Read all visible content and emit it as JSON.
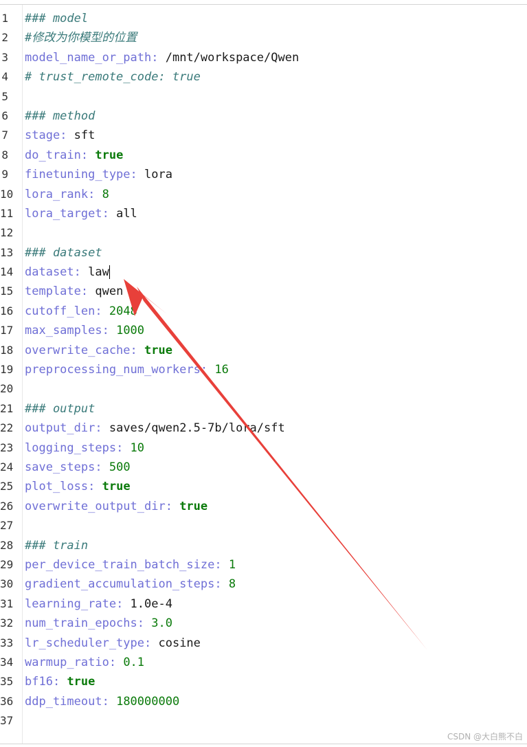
{
  "editor": {
    "lines": [
      {
        "n": "1",
        "tokens": [
          {
            "t": "### model",
            "c": "comment"
          }
        ]
      },
      {
        "n": "2",
        "tokens": [
          {
            "t": "#修改为你模型的位置",
            "c": "comment"
          }
        ]
      },
      {
        "n": "3",
        "tokens": [
          {
            "t": "model_name_or_path",
            "c": "key"
          },
          {
            "t": ": ",
            "c": "colon"
          },
          {
            "t": "/mnt/workspace/Qwen",
            "c": "str"
          }
        ]
      },
      {
        "n": "4",
        "tokens": [
          {
            "t": "# trust_remote_code: true",
            "c": "comment"
          }
        ]
      },
      {
        "n": "5",
        "tokens": []
      },
      {
        "n": "6",
        "tokens": [
          {
            "t": "### method",
            "c": "comment"
          }
        ]
      },
      {
        "n": "7",
        "tokens": [
          {
            "t": "stage",
            "c": "key"
          },
          {
            "t": ": ",
            "c": "colon"
          },
          {
            "t": "sft",
            "c": "str"
          }
        ]
      },
      {
        "n": "8",
        "tokens": [
          {
            "t": "do_train",
            "c": "key"
          },
          {
            "t": ": ",
            "c": "colon"
          },
          {
            "t": "true",
            "c": "bool"
          }
        ]
      },
      {
        "n": "9",
        "tokens": [
          {
            "t": "finetuning_type",
            "c": "key"
          },
          {
            "t": ": ",
            "c": "colon"
          },
          {
            "t": "lora",
            "c": "str"
          }
        ]
      },
      {
        "n": "10",
        "tokens": [
          {
            "t": "lora_rank",
            "c": "key"
          },
          {
            "t": ": ",
            "c": "colon"
          },
          {
            "t": "8",
            "c": "num"
          }
        ]
      },
      {
        "n": "11",
        "tokens": [
          {
            "t": "lora_target",
            "c": "key"
          },
          {
            "t": ": ",
            "c": "colon"
          },
          {
            "t": "all",
            "c": "str"
          }
        ]
      },
      {
        "n": "12",
        "tokens": []
      },
      {
        "n": "13",
        "tokens": [
          {
            "t": "### dataset",
            "c": "comment"
          }
        ]
      },
      {
        "n": "14",
        "tokens": [
          {
            "t": "dataset",
            "c": "key"
          },
          {
            "t": ": ",
            "c": "colon"
          },
          {
            "t": "law",
            "c": "str"
          }
        ],
        "cursor": true
      },
      {
        "n": "15",
        "tokens": [
          {
            "t": "template",
            "c": "key"
          },
          {
            "t": ": ",
            "c": "colon"
          },
          {
            "t": "qwen",
            "c": "str"
          }
        ]
      },
      {
        "n": "16",
        "tokens": [
          {
            "t": "cutoff_len",
            "c": "key"
          },
          {
            "t": ": ",
            "c": "colon"
          },
          {
            "t": "2048",
            "c": "num"
          }
        ]
      },
      {
        "n": "17",
        "tokens": [
          {
            "t": "max_samples",
            "c": "key"
          },
          {
            "t": ": ",
            "c": "colon"
          },
          {
            "t": "1000",
            "c": "num"
          }
        ]
      },
      {
        "n": "18",
        "tokens": [
          {
            "t": "overwrite_cache",
            "c": "key"
          },
          {
            "t": ": ",
            "c": "colon"
          },
          {
            "t": "true",
            "c": "bool"
          }
        ]
      },
      {
        "n": "19",
        "tokens": [
          {
            "t": "preprocessing_num_workers",
            "c": "key"
          },
          {
            "t": ": ",
            "c": "colon"
          },
          {
            "t": "16",
            "c": "num"
          }
        ]
      },
      {
        "n": "20",
        "tokens": []
      },
      {
        "n": "21",
        "tokens": [
          {
            "t": "### output",
            "c": "comment"
          }
        ]
      },
      {
        "n": "22",
        "tokens": [
          {
            "t": "output_dir",
            "c": "key"
          },
          {
            "t": ": ",
            "c": "colon"
          },
          {
            "t": "saves/qwen2.5-7b/lora/sft",
            "c": "str"
          }
        ]
      },
      {
        "n": "23",
        "tokens": [
          {
            "t": "logging_steps",
            "c": "key"
          },
          {
            "t": ": ",
            "c": "colon"
          },
          {
            "t": "10",
            "c": "num"
          }
        ]
      },
      {
        "n": "24",
        "tokens": [
          {
            "t": "save_steps",
            "c": "key"
          },
          {
            "t": ": ",
            "c": "colon"
          },
          {
            "t": "500",
            "c": "num"
          }
        ]
      },
      {
        "n": "25",
        "tokens": [
          {
            "t": "plot_loss",
            "c": "key"
          },
          {
            "t": ": ",
            "c": "colon"
          },
          {
            "t": "true",
            "c": "bool"
          }
        ]
      },
      {
        "n": "26",
        "tokens": [
          {
            "t": "overwrite_output_dir",
            "c": "key"
          },
          {
            "t": ": ",
            "c": "colon"
          },
          {
            "t": "true",
            "c": "bool"
          }
        ]
      },
      {
        "n": "27",
        "tokens": []
      },
      {
        "n": "28",
        "tokens": [
          {
            "t": "### train",
            "c": "comment"
          }
        ]
      },
      {
        "n": "29",
        "tokens": [
          {
            "t": "per_device_train_batch_size",
            "c": "key"
          },
          {
            "t": ": ",
            "c": "colon"
          },
          {
            "t": "1",
            "c": "num"
          }
        ]
      },
      {
        "n": "30",
        "tokens": [
          {
            "t": "gradient_accumulation_steps",
            "c": "key"
          },
          {
            "t": ": ",
            "c": "colon"
          },
          {
            "t": "8",
            "c": "num"
          }
        ]
      },
      {
        "n": "31",
        "tokens": [
          {
            "t": "learning_rate",
            "c": "key"
          },
          {
            "t": ": ",
            "c": "colon"
          },
          {
            "t": "1.0e-4",
            "c": "str"
          }
        ]
      },
      {
        "n": "32",
        "tokens": [
          {
            "t": "num_train_epochs",
            "c": "key"
          },
          {
            "t": ": ",
            "c": "colon"
          },
          {
            "t": "3.0",
            "c": "num"
          }
        ]
      },
      {
        "n": "33",
        "tokens": [
          {
            "t": "lr_scheduler_type",
            "c": "key"
          },
          {
            "t": ": ",
            "c": "colon"
          },
          {
            "t": "cosine",
            "c": "str"
          }
        ]
      },
      {
        "n": "34",
        "tokens": [
          {
            "t": "warmup_ratio",
            "c": "key"
          },
          {
            "t": ": ",
            "c": "colon"
          },
          {
            "t": "0.1",
            "c": "num"
          }
        ]
      },
      {
        "n": "35",
        "tokens": [
          {
            "t": "bf16",
            "c": "key"
          },
          {
            "t": ": ",
            "c": "colon"
          },
          {
            "t": "true",
            "c": "bool"
          }
        ]
      },
      {
        "n": "36",
        "tokens": [
          {
            "t": "ddp_timeout",
            "c": "key"
          },
          {
            "t": ": ",
            "c": "colon"
          },
          {
            "t": "180000000",
            "c": "num"
          }
        ]
      },
      {
        "n": "37",
        "tokens": []
      }
    ]
  },
  "annotation": {
    "icon": "red-arrow-icon",
    "color": "#e8403a"
  },
  "watermark": "CSDN @大白熊不白"
}
